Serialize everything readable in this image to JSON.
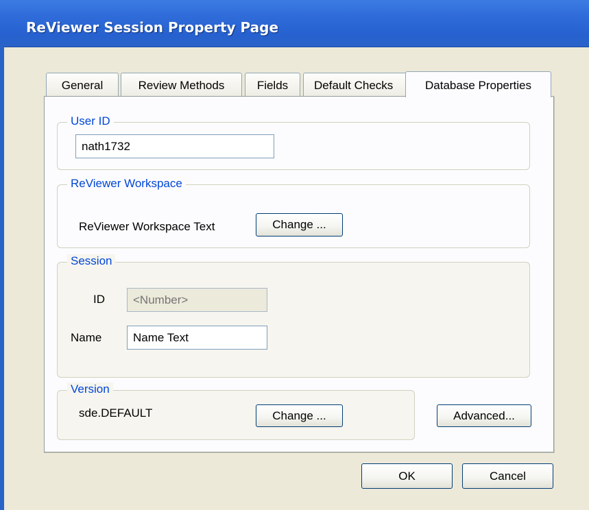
{
  "window": {
    "title": "ReViewer Session Property Page"
  },
  "tabs": [
    {
      "label": "General"
    },
    {
      "label": "Review Methods"
    },
    {
      "label": "Fields"
    },
    {
      "label": "Default Checks"
    },
    {
      "label": "Database Properties"
    }
  ],
  "user_id": {
    "legend": "User ID",
    "value": "nath1732"
  },
  "workspace": {
    "legend": "ReViewer Workspace",
    "label": "ReViewer Workspace Text",
    "change_label": "Change ..."
  },
  "session": {
    "legend": "Session",
    "id_label": "ID",
    "id_placeholder": "<Number>",
    "name_label": "Name",
    "name_value": "Name Text"
  },
  "version": {
    "legend": "Version",
    "value": "sde.DEFAULT",
    "change_label": "Change ..."
  },
  "advanced_label": "Advanced...",
  "dialog": {
    "ok_label": "OK",
    "cancel_label": "Cancel"
  }
}
